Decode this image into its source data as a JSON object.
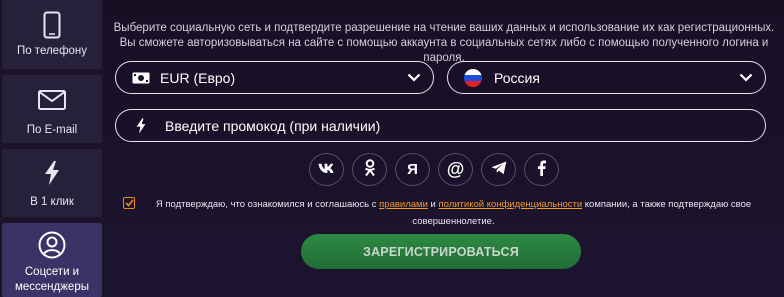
{
  "tabs": [
    {
      "label": "По телефону",
      "icon": "phone-icon"
    },
    {
      "label": "По E-mail",
      "icon": "mail-icon"
    },
    {
      "label": "В 1 клик",
      "icon": "lightning-icon"
    },
    {
      "label_line1": "Соцсети и",
      "label_line2": "мессенджеры",
      "icon": "user-circle-icon",
      "active": true
    }
  ],
  "info": {
    "line1": "Выберите социальную сеть и подтвердите разрешение на чтение ваших данных и использование их как регистрационных.",
    "line2": "Вы сможете авторизовываться на сайте с помощью аккаунта в социальных сетях либо с помощью полученного логина и пароля."
  },
  "currency": {
    "value": "EUR (Евро)",
    "icon": "money-icon"
  },
  "country": {
    "value": "Россия",
    "icon": "flag-russia-icon"
  },
  "promo": {
    "placeholder": "Введите промокод (при наличии)",
    "icon": "lightning-icon"
  },
  "socials": [
    {
      "name": "vk",
      "glyph": "vk"
    },
    {
      "name": "odnoklassniki",
      "glyph": "ok"
    },
    {
      "name": "yandex",
      "glyph": "Я"
    },
    {
      "name": "mail-ru",
      "glyph": "@"
    },
    {
      "name": "telegram",
      "glyph": "tg"
    },
    {
      "name": "facebook",
      "glyph": "f"
    }
  ],
  "consent": {
    "checked": true,
    "text_before": "Я подтверждаю, что ознакомился и соглашаюсь с ",
    "rules_link": "правилами",
    "text_and": " и ",
    "privacy_link": "политикой конфиденциальности",
    "text_after": " компании, а также подтверждаю свое совершеннолетие."
  },
  "register_label": "ЗАРЕГИСТРИРОВАТЬСЯ",
  "colors": {
    "background": "#1a1228",
    "tab": "#27203a",
    "tab_active": "#3a3466",
    "accent_orange": "#f29a2a",
    "button_green": "#2e8a44"
  }
}
